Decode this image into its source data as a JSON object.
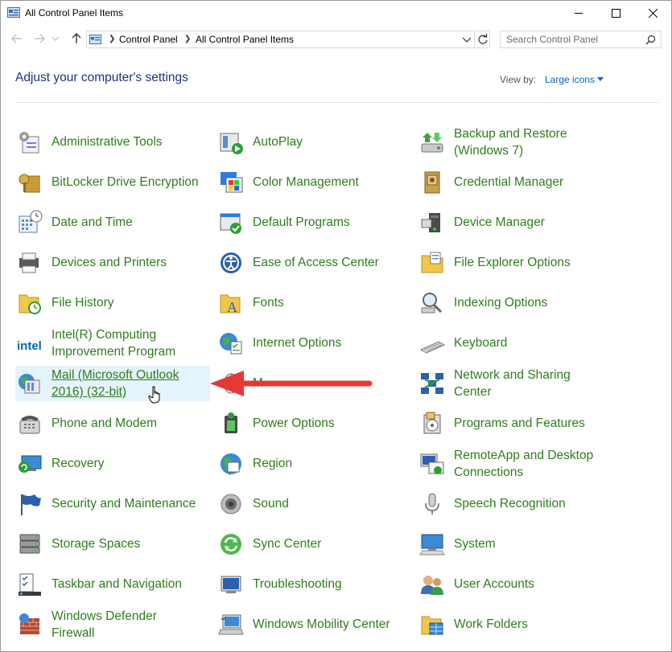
{
  "window": {
    "title": "All Control Panel Items",
    "controls": {
      "minimize": "minimize",
      "maximize": "maximize",
      "close": "close"
    }
  },
  "address_bar": {
    "breadcrumbs": [
      "Control Panel",
      "All Control Panel Items"
    ],
    "search_placeholder": "Search Control Panel"
  },
  "content": {
    "heading": "Adjust your computer's settings",
    "view_by_label": "View by:",
    "view_by_value": "Large icons"
  },
  "items": [
    {
      "label_lines": [
        "Administrative Tools"
      ],
      "icon": "admin-tools-icon"
    },
    {
      "label_lines": [
        "AutoPlay"
      ],
      "icon": "autoplay-icon"
    },
    {
      "label_lines": [
        "Backup and Restore",
        "(Windows 7)"
      ],
      "icon": "backup-restore-icon"
    },
    {
      "label_lines": [
        "BitLocker Drive Encryption"
      ],
      "icon": "bitlocker-icon"
    },
    {
      "label_lines": [
        "Color Management"
      ],
      "icon": "color-management-icon"
    },
    {
      "label_lines": [
        "Credential Manager"
      ],
      "icon": "credential-manager-icon"
    },
    {
      "label_lines": [
        "Date and Time"
      ],
      "icon": "date-time-icon"
    },
    {
      "label_lines": [
        "Default Programs"
      ],
      "icon": "default-programs-icon"
    },
    {
      "label_lines": [
        "Device Manager"
      ],
      "icon": "device-manager-icon"
    },
    {
      "label_lines": [
        "Devices and Printers"
      ],
      "icon": "devices-printers-icon"
    },
    {
      "label_lines": [
        "Ease of Access Center"
      ],
      "icon": "ease-of-access-icon"
    },
    {
      "label_lines": [
        "File Explorer Options"
      ],
      "icon": "file-explorer-options-icon"
    },
    {
      "label_lines": [
        "File History"
      ],
      "icon": "file-history-icon"
    },
    {
      "label_lines": [
        "Fonts"
      ],
      "icon": "fonts-icon"
    },
    {
      "label_lines": [
        "Indexing Options"
      ],
      "icon": "indexing-options-icon"
    },
    {
      "label_lines": [
        "Intel(R) Computing",
        "Improvement Program"
      ],
      "icon": "intel-icon"
    },
    {
      "label_lines": [
        "Internet Options"
      ],
      "icon": "internet-options-icon"
    },
    {
      "label_lines": [
        "Keyboard"
      ],
      "icon": "keyboard-icon"
    },
    {
      "label_lines": [
        "Mail (Microsoft Outlook",
        "2016) (32-bit)"
      ],
      "icon": "mail-icon",
      "hover": true
    },
    {
      "label_lines": [
        "M"
      ],
      "icon": "mouse-icon"
    },
    {
      "label_lines": [
        "Network and Sharing",
        "Center"
      ],
      "icon": "network-sharing-icon"
    },
    {
      "label_lines": [
        "Phone and Modem"
      ],
      "icon": "phone-modem-icon"
    },
    {
      "label_lines": [
        "Power Options"
      ],
      "icon": "power-options-icon"
    },
    {
      "label_lines": [
        "Programs and Features"
      ],
      "icon": "programs-features-icon"
    },
    {
      "label_lines": [
        "Recovery"
      ],
      "icon": "recovery-icon"
    },
    {
      "label_lines": [
        "Region"
      ],
      "icon": "region-icon"
    },
    {
      "label_lines": [
        "RemoteApp and Desktop",
        "Connections"
      ],
      "icon": "remoteapp-icon"
    },
    {
      "label_lines": [
        "Security and Maintenance"
      ],
      "icon": "security-maintenance-icon"
    },
    {
      "label_lines": [
        "Sound"
      ],
      "icon": "sound-icon"
    },
    {
      "label_lines": [
        "Speech Recognition"
      ],
      "icon": "speech-recognition-icon"
    },
    {
      "label_lines": [
        "Storage Spaces"
      ],
      "icon": "storage-spaces-icon"
    },
    {
      "label_lines": [
        "Sync Center"
      ],
      "icon": "sync-center-icon"
    },
    {
      "label_lines": [
        "System"
      ],
      "icon": "system-icon"
    },
    {
      "label_lines": [
        "Taskbar and Navigation"
      ],
      "icon": "taskbar-navigation-icon"
    },
    {
      "label_lines": [
        "Troubleshooting"
      ],
      "icon": "troubleshooting-icon"
    },
    {
      "label_lines": [
        "User Accounts"
      ],
      "icon": "user-accounts-icon"
    },
    {
      "label_lines": [
        "Windows Defender",
        "Firewall"
      ],
      "icon": "firewall-icon"
    },
    {
      "label_lines": [
        "Windows Mobility Center"
      ],
      "icon": "mobility-center-icon"
    },
    {
      "label_lines": [
        "Work Folders"
      ],
      "icon": "work-folders-icon"
    }
  ],
  "annotation": {
    "arrow_color": "#e53935",
    "arrow_icon": "red-arrow-icon"
  },
  "colors": {
    "link_green": "#2f7d1e",
    "heading_blue": "#1e3287",
    "hover_bg": "#e5f3fb"
  }
}
